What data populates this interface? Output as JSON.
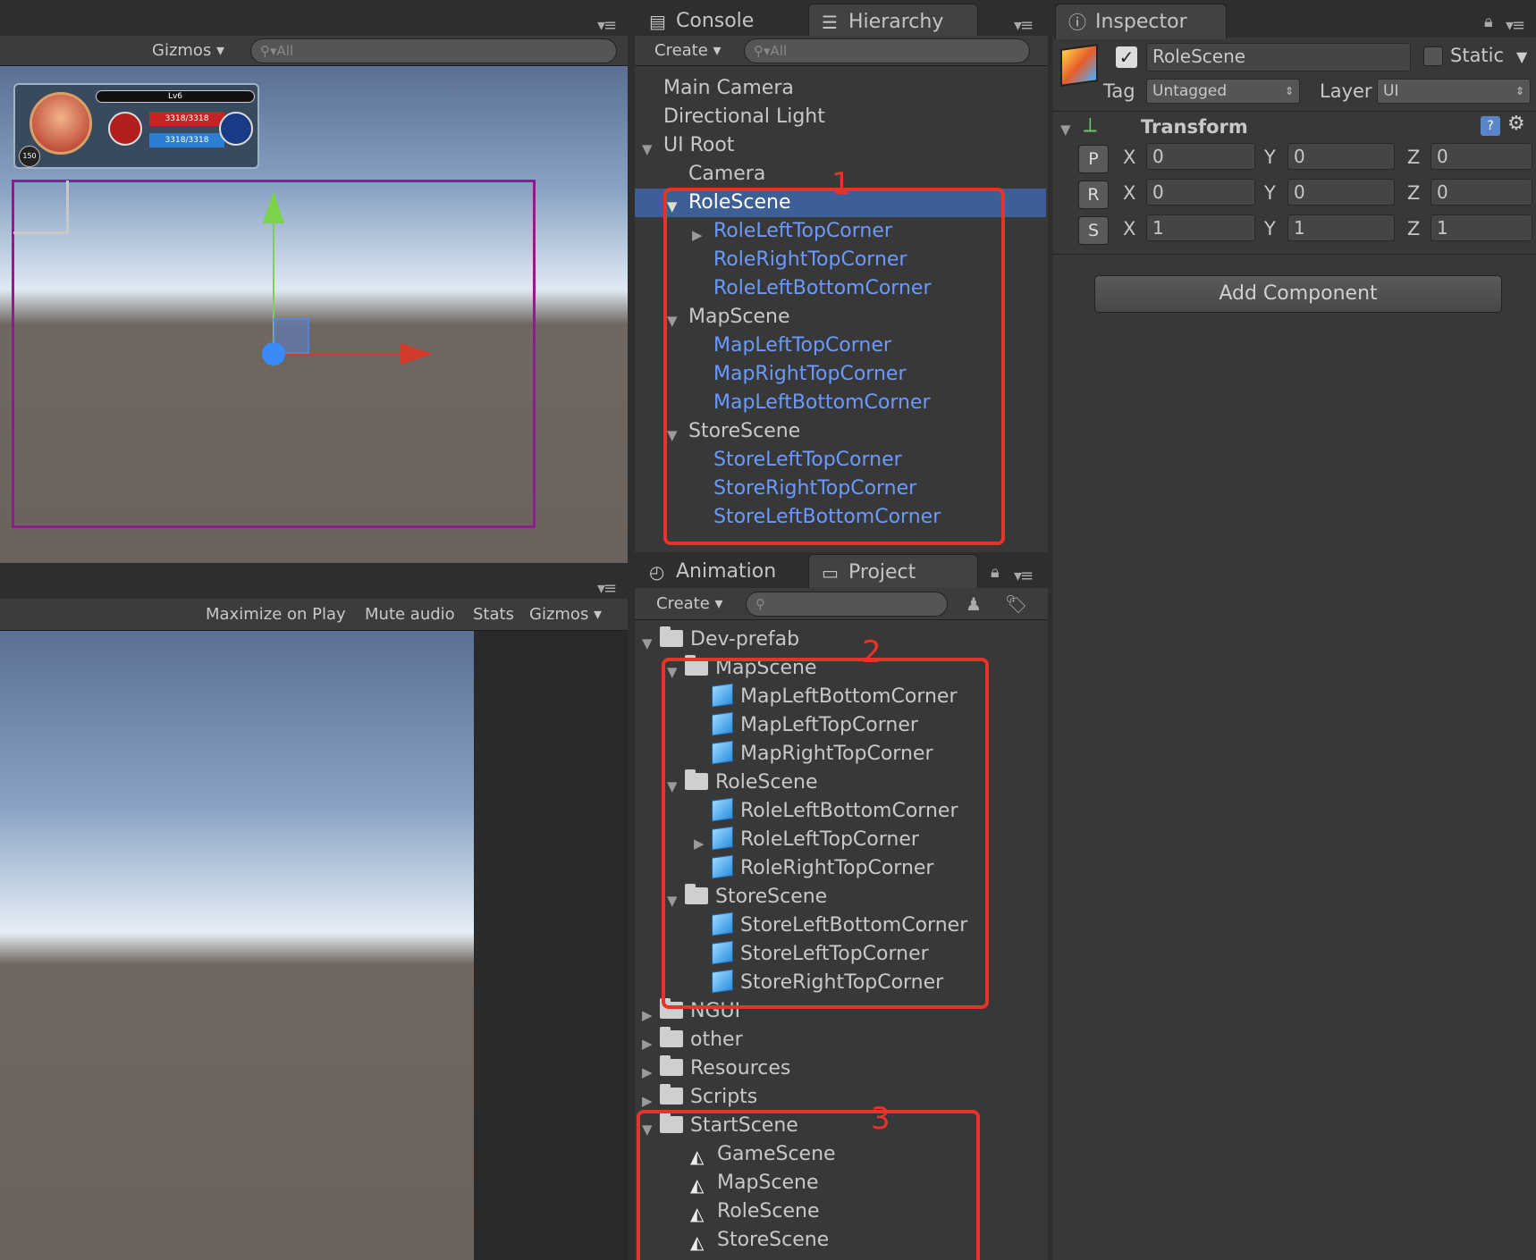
{
  "scene_view": {
    "gizmos": "Gizmos",
    "search": "All",
    "hud_level": "Lv6",
    "hud_hp": "3318/3318",
    "hud_mp": "3318/3318",
    "hud_badge": "150"
  },
  "game_view": {
    "buttons": [
      "Maximize on Play",
      "Mute audio",
      "Stats",
      "Gizmos"
    ]
  },
  "console_tab": {
    "label": "Console"
  },
  "hierarchy": {
    "tab": "Hierarchy",
    "create": "Create",
    "search": "All",
    "items": [
      "Main Camera",
      "Directional Light",
      "UI Root",
      "Camera",
      "RoleScene",
      "RoleLeftTopCorner",
      "RoleRightTopCorner",
      "RoleLeftBottomCorner",
      "MapScene",
      "MapLeftTopCorner",
      "MapRightTopCorner",
      "MapLeftBottomCorner",
      "StoreScene",
      "StoreLeftTopCorner",
      "StoreRightTopCorner",
      "StoreLeftBottomCorner"
    ]
  },
  "animation_tab": {
    "label": "Animation"
  },
  "project": {
    "tab": "Project",
    "create": "Create",
    "items": [
      "Dev-prefab",
      "MapScene",
      "MapLeftBottomCorner",
      "MapLeftTopCorner",
      "MapRightTopCorner",
      "RoleScene",
      "RoleLeftBottomCorner",
      "RoleLeftTopCorner",
      "RoleRightTopCorner",
      "StoreScene",
      "StoreLeftBottomCorner",
      "StoreLeftTopCorner",
      "StoreRightTopCorner",
      "NGUI",
      "other",
      "Resources",
      "Scripts",
      "StartScene",
      "GameScene",
      "MapScene",
      "RoleScene",
      "StoreScene"
    ]
  },
  "inspector": {
    "tab": "Inspector",
    "name": "RoleScene",
    "static": "Static",
    "tag_label": "Tag",
    "tag_value": "Untagged",
    "layer_label": "Layer",
    "layer_value": "UI",
    "transform": "Transform",
    "rows": [
      {
        "btn": "P",
        "x": "0",
        "y": "0",
        "z": "0"
      },
      {
        "btn": "R",
        "x": "0",
        "y": "0",
        "z": "0"
      },
      {
        "btn": "S",
        "x": "1",
        "y": "1",
        "z": "1"
      }
    ],
    "axis": {
      "x": "X",
      "y": "Y",
      "z": "Z"
    },
    "add_component": "Add Component"
  },
  "annotations": [
    "1",
    "2",
    "3"
  ],
  "colors": {
    "selection": "#3e5f96",
    "prefab": "#6b9aff",
    "annotation": "#e8332b"
  }
}
